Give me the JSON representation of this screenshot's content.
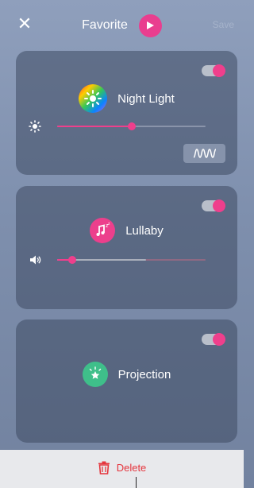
{
  "header": {
    "title": "Favorite",
    "close_icon": "close-icon",
    "play_icon": "play-icon",
    "save_label": "Save"
  },
  "colors": {
    "accent": "#ef3f8c",
    "delete": "#e5353d"
  },
  "cards": [
    {
      "label": "Night Light",
      "icon": "rainbow-sun-icon",
      "enabled": true,
      "slider_icon": "brightness-icon",
      "slider_value": 0.5,
      "wave_button_icon": "waveform-icon"
    },
    {
      "label": "Lullaby",
      "icon": "music-note-icon",
      "enabled": true,
      "slider_icon": "volume-icon",
      "slider_value": 0.1,
      "slider_buffer": 0.6
    },
    {
      "label": "Projection",
      "icon": "star-projection-icon",
      "enabled": true
    }
  ],
  "footer": {
    "delete_label": "Delete",
    "delete_icon": "trash-icon"
  }
}
